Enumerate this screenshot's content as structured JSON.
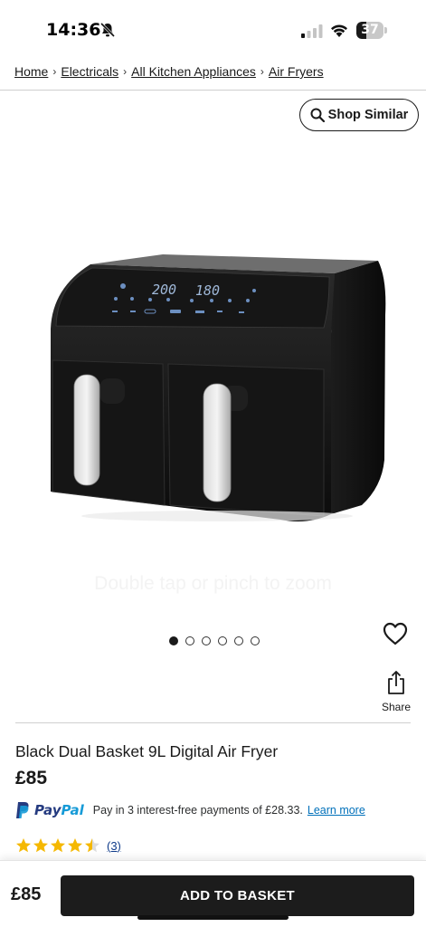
{
  "status_bar": {
    "time": "14:36",
    "battery": "37",
    "battery_fraction": 0.37,
    "icons": [
      "bell-slash-icon",
      "cellular-signal-icon",
      "wifi-icon",
      "battery-icon"
    ]
  },
  "breadcrumb": {
    "items": [
      {
        "label": "Home"
      },
      {
        "label": "Electricals"
      },
      {
        "label": "All Kitchen Appliances"
      },
      {
        "label": "Air Fryers"
      }
    ],
    "separator": "›"
  },
  "shop_similar": {
    "label": "Shop Similar",
    "icon": "search-icon"
  },
  "product_image": {
    "display_left": "200",
    "display_right": "180",
    "zoom_hint": "Double tap or pinch to zoom"
  },
  "carousel": {
    "count": 6,
    "active_index": 0
  },
  "actions": {
    "favourite_icon": "heart-icon",
    "share_icon": "share-icon",
    "share_label": "Share"
  },
  "product": {
    "title": "Black Dual Basket 9L Digital Air Fryer",
    "price": "£85"
  },
  "paypal": {
    "logo_pay": "Pay",
    "logo_pal": "Pal",
    "text": "Pay in 3 interest-free payments of £28.33.",
    "link": "Learn more"
  },
  "rating": {
    "stars": 4.5,
    "max_stars": 5,
    "review_count": "(3)",
    "star_color": "#f5b800"
  },
  "footer": {
    "price": "£85",
    "button_label": "ADD TO BASKET"
  },
  "colors": {
    "primary_button": "#1c1c1c",
    "paypal_blue": "#253b80",
    "paypal_light_blue": "#179bd7",
    "link_blue": "#0070ba"
  }
}
